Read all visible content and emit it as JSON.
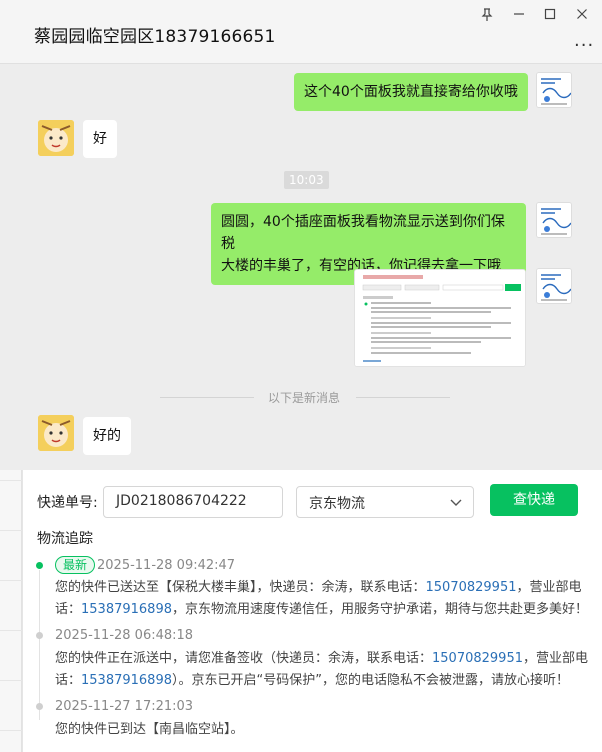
{
  "window": {
    "title": "蔡园园临空园区18379166651",
    "controls": {
      "pin": "pin-icon",
      "minimize": "minimize-icon",
      "maximize": "maximize-icon",
      "close": "close-icon"
    },
    "more": "..."
  },
  "chat": {
    "messages": [
      {
        "side": "right",
        "text": "这个40个面板我就直接寄给你收哦"
      },
      {
        "side": "left",
        "text": "好"
      },
      {
        "side": "right",
        "text1": "圆圆，40个插座面板我看物流显示送到你们保税",
        "text2": "大楼的丰巢了，有空的话，你记得去拿一下哦"
      },
      {
        "side": "left",
        "text": "好的"
      }
    ],
    "time_chip": "10:03",
    "new_messages_divider": "以下是新消息"
  },
  "logistics": {
    "tracking_label": "快递单号:",
    "tracking_value": "JD0218086704222",
    "carrier_selected": "京东物流",
    "query_button": "查快递",
    "section_title": "物流追踪",
    "latest_badge": "最新",
    "events": [
      {
        "time": "2025-11-28 09:42:47",
        "line1_a": "您的快件已送达至【保税大楼丰巢】，快递员：余涛，联系电话：",
        "line1_phone": "15070829951",
        "line1_b": "，营业部电",
        "line2_a": "话：",
        "line2_phone": "15387916898",
        "line2_b": "，京东物流用速度传递信任，用服务守护承诺，期待与您共赴更多美好！"
      },
      {
        "time": "2025-11-28 06:48:18",
        "line1_a": "您的快件正在派送中，请您准备签收（快递员：余涛，联系电话：",
        "line1_phone": "15070829951",
        "line1_b": "，营业部电",
        "line2_a": "话：",
        "line2_phone": "15387916898",
        "line2_b": "）。京东已开启“号码保护”，您的电话隐私不会被泄露，请放心接听！"
      },
      {
        "time": "2025-11-27 17:21:03",
        "line1_a": "您的快件已到达【南昌临空站】。"
      }
    ],
    "colors": {
      "accent": "#07c160",
      "phone": "#2a6fb6",
      "bubble_me": "#95ec69"
    }
  }
}
